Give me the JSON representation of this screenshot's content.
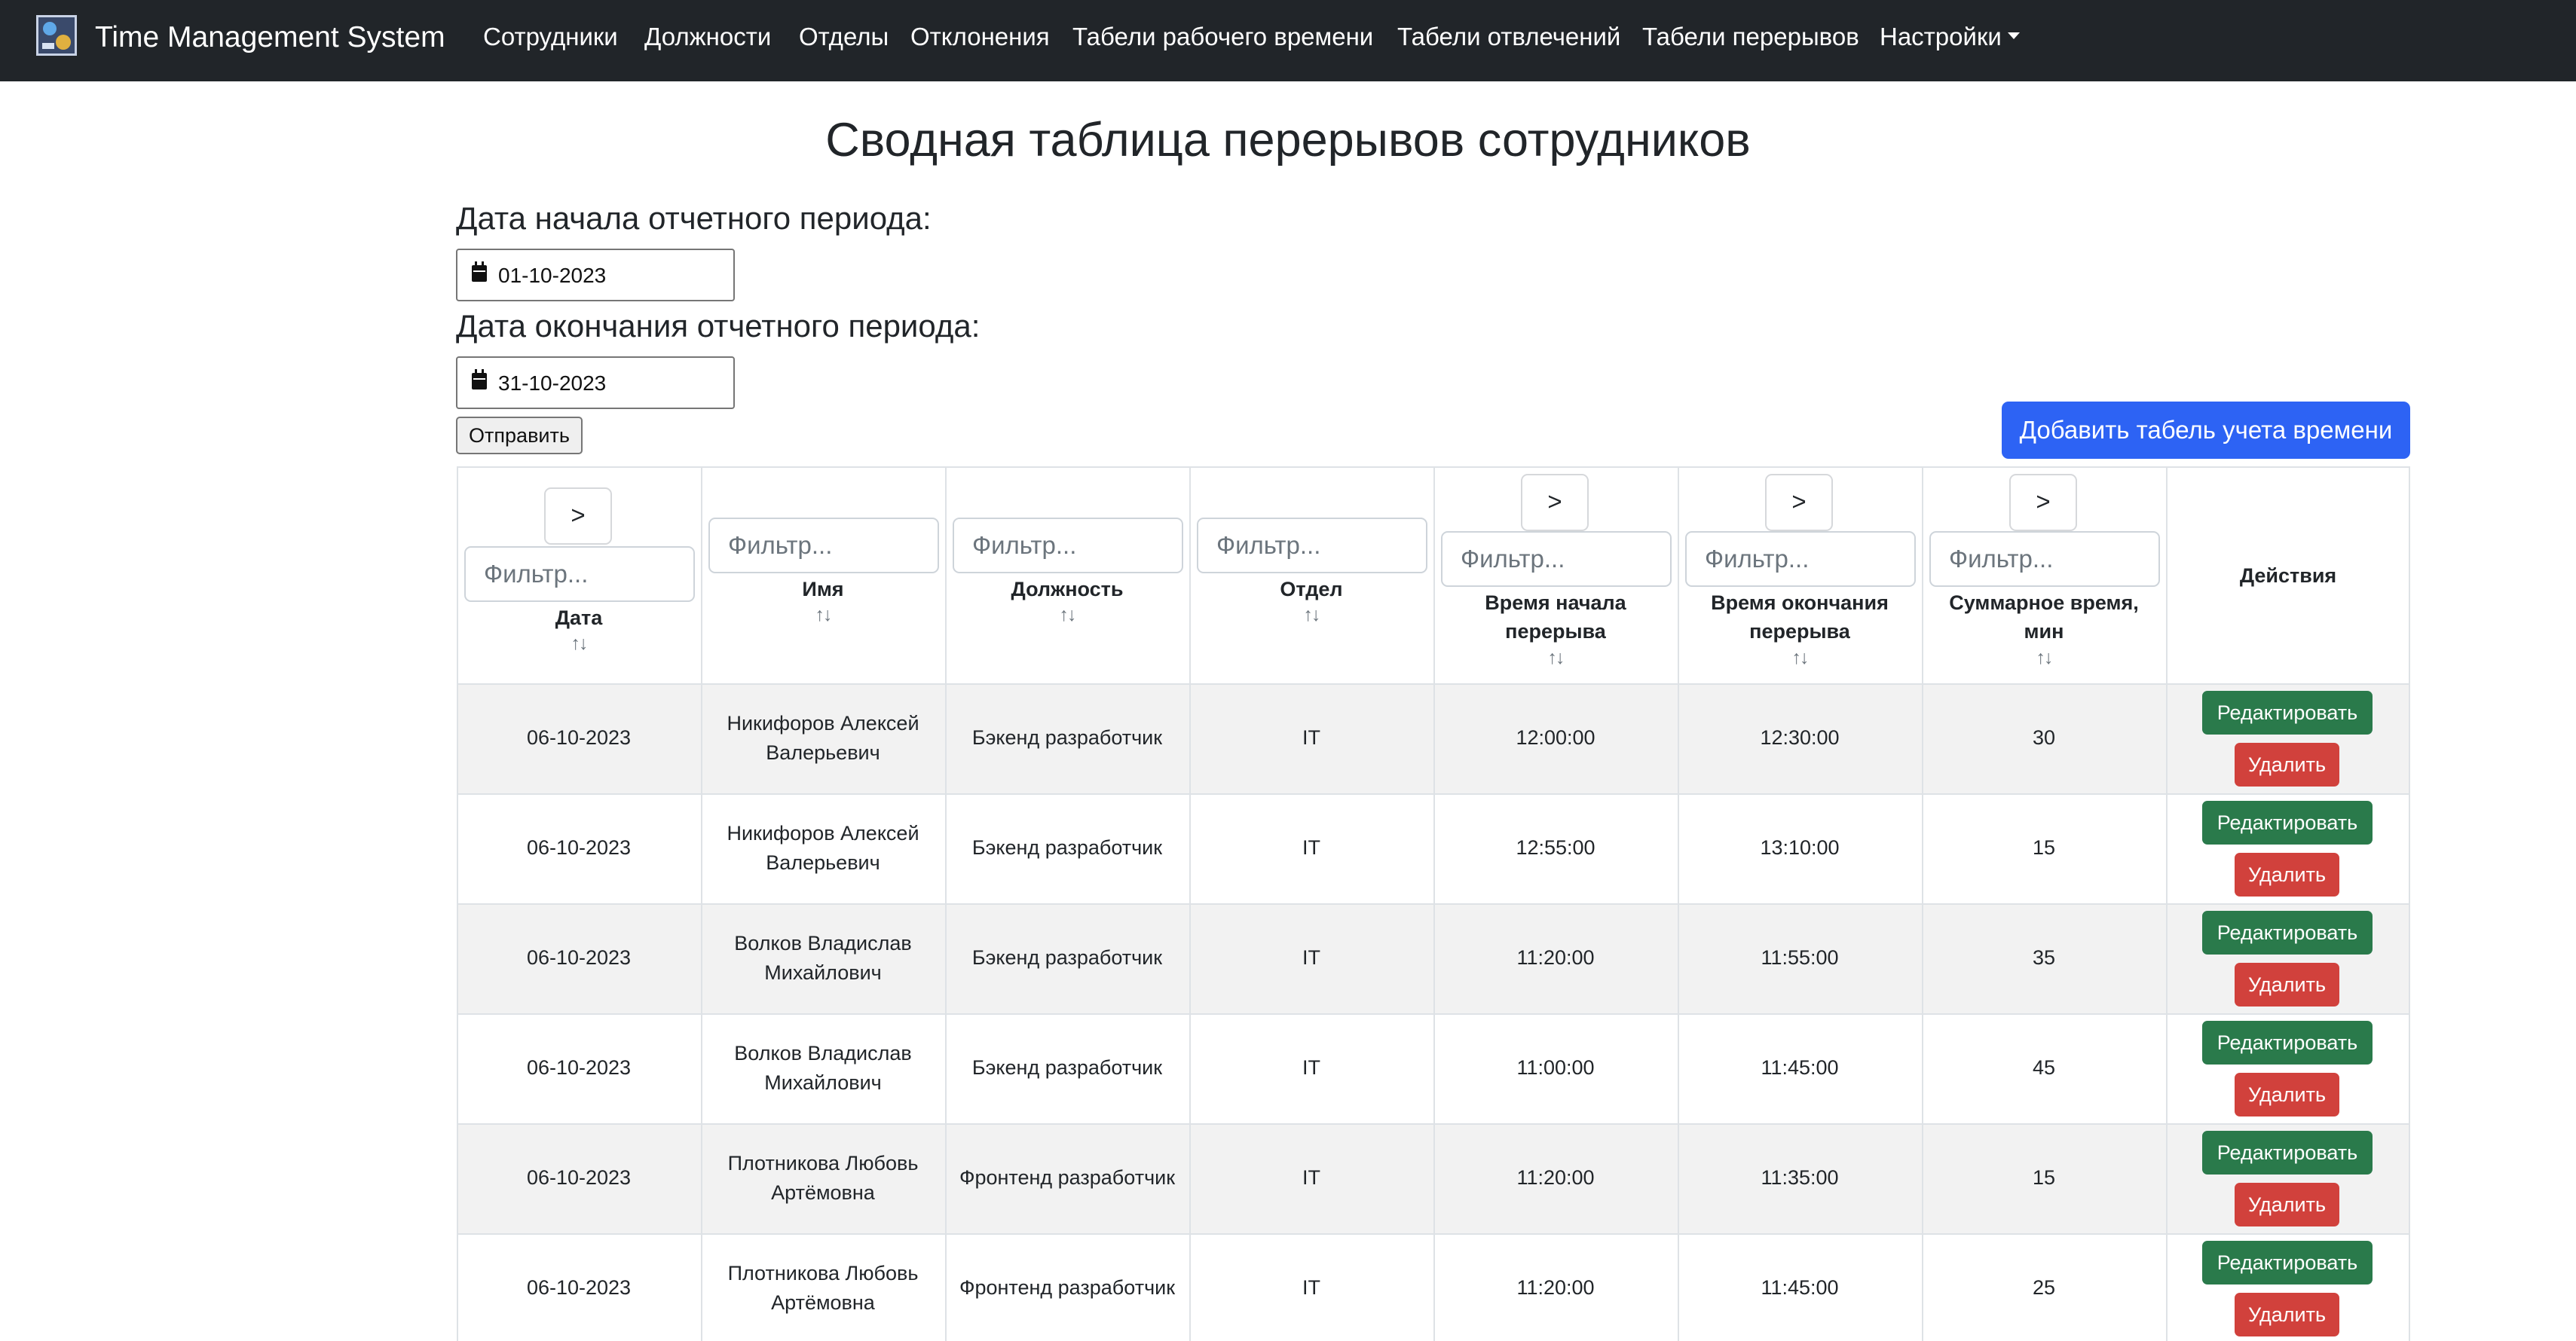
{
  "navbar": {
    "brand": "Time Management System",
    "items": [
      {
        "label": "Сотрудники"
      },
      {
        "label": "Должности"
      },
      {
        "label": "Отделы"
      },
      {
        "label": "Отклонения"
      },
      {
        "label": "Табели рабочего времени"
      },
      {
        "label": "Табели отвлечений"
      },
      {
        "label": "Табели перерывов"
      },
      {
        "label": "Настройки"
      }
    ]
  },
  "page": {
    "title": "Сводная таблица перерывов сотрудников",
    "start_label": "Дата начала отчетного периода:",
    "start_value": "01-10-2023",
    "end_label": "Дата окончания отчетного периода:",
    "end_value": "31-10-2023",
    "submit_label": "Отправить",
    "add_label": "Добавить табель учета времени"
  },
  "table": {
    "filter_placeholder": "Фильтр...",
    "compare_symbol": ">",
    "sort_symbol": "↑↓",
    "columns": [
      {
        "line1": "Дата",
        "line2": ""
      },
      {
        "line1": "Имя",
        "line2": ""
      },
      {
        "line1": "Должность",
        "line2": ""
      },
      {
        "line1": "Отдел",
        "line2": ""
      },
      {
        "line1": "Время начала",
        "line2": "перерыва"
      },
      {
        "line1": "Время окончания",
        "line2": "перерыва"
      },
      {
        "line1": "Суммарное время,",
        "line2": "мин"
      },
      {
        "line1": "Действия",
        "line2": ""
      }
    ],
    "edit_label": "Редактировать",
    "delete_label": "Удалить",
    "rows": [
      {
        "date": "06-10-2023",
        "name1": "Никифоров Алексей",
        "name2": "Валерьевич",
        "position": "Бэкенд разработчик",
        "dept": "IT",
        "start": "12:00:00",
        "end": "12:30:00",
        "total": "30"
      },
      {
        "date": "06-10-2023",
        "name1": "Никифоров Алексей",
        "name2": "Валерьевич",
        "position": "Бэкенд разработчик",
        "dept": "IT",
        "start": "12:55:00",
        "end": "13:10:00",
        "total": "15"
      },
      {
        "date": "06-10-2023",
        "name1": "Волков Владислав",
        "name2": "Михайлович",
        "position": "Бэкенд разработчик",
        "dept": "IT",
        "start": "11:20:00",
        "end": "11:55:00",
        "total": "35"
      },
      {
        "date": "06-10-2023",
        "name1": "Волков Владислав",
        "name2": "Михайлович",
        "position": "Бэкенд разработчик",
        "dept": "IT",
        "start": "11:00:00",
        "end": "11:45:00",
        "total": "45"
      },
      {
        "date": "06-10-2023",
        "name1": "Плотникова Любовь",
        "name2": "Артёмовна",
        "position": "Фронтенд разработчик",
        "dept": "IT",
        "start": "11:20:00",
        "end": "11:35:00",
        "total": "15"
      },
      {
        "date": "06-10-2023",
        "name1": "Плотникова Любовь",
        "name2": "Артёмовна",
        "position": "Фронтенд разработчик",
        "dept": "IT",
        "start": "11:20:00",
        "end": "11:45:00",
        "total": "25"
      }
    ]
  }
}
